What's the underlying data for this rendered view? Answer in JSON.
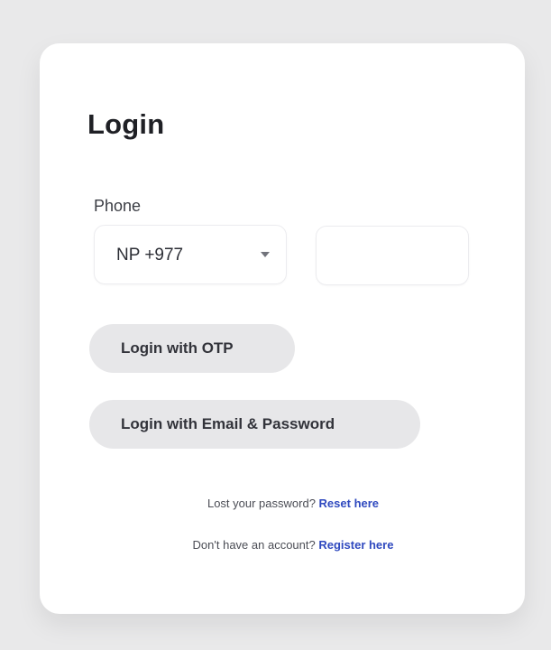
{
  "login": {
    "title": "Login",
    "phone_label": "Phone",
    "country_code": "NP +977",
    "phone_number": "",
    "otp_button": "Login with OTP",
    "email_button": "Login with Email & Password",
    "lost_password_text": "Lost your password?",
    "reset_link": "Reset here",
    "no_account_text": "Don't have an account?",
    "register_link": "Register here"
  },
  "colors": {
    "page_background": "#e9e9ea",
    "card_background": "#ffffff",
    "button_background": "#e7e7e9",
    "link": "#2f49bf",
    "heading": "#1f2025"
  },
  "icons": {
    "country_dropdown": "chevron-down-icon"
  }
}
